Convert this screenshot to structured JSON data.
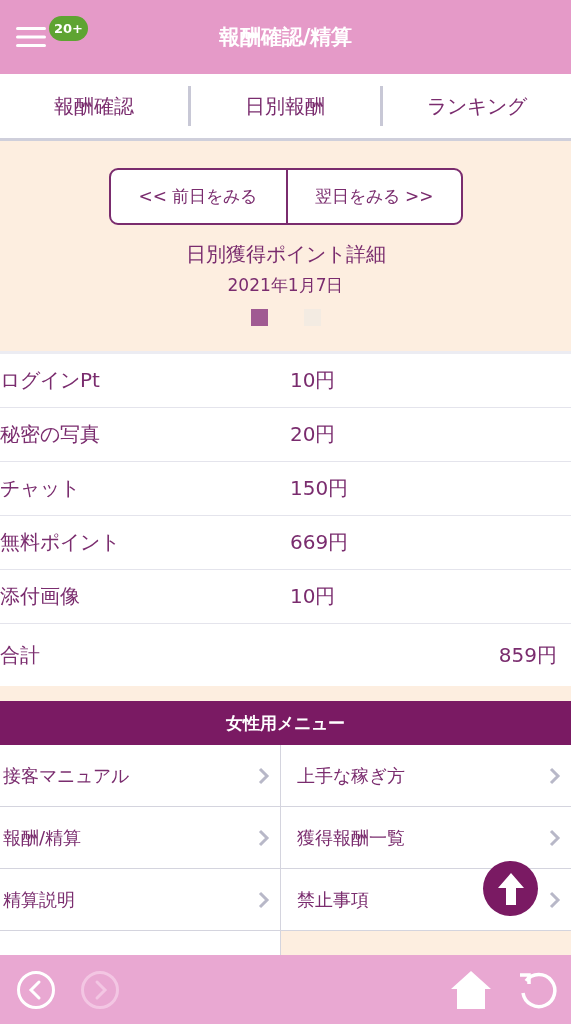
{
  "header": {
    "title": "報酬確認/精算",
    "badge": "20+"
  },
  "tabs": [
    {
      "label": "報酬確認"
    },
    {
      "label": "日別報酬"
    },
    {
      "label": "ランキング"
    }
  ],
  "day_nav": {
    "prev": "<< 前日をみる",
    "next": "翌日をみる >>"
  },
  "detail": {
    "title": "日別獲得ポイント詳細",
    "date": "2021年1月7日"
  },
  "pager": [
    {
      "selected": true
    },
    {
      "selected": false
    }
  ],
  "rows": [
    {
      "kind": "item",
      "name": "ログインPt",
      "value": "10円"
    },
    {
      "kind": "item",
      "name": "秘密の写真",
      "value": "20円"
    },
    {
      "kind": "item",
      "name": "チャット",
      "value": "150円"
    },
    {
      "kind": "item",
      "name": "無料ポイント",
      "value": "669円"
    },
    {
      "kind": "item",
      "name": "添付画像",
      "value": "10円"
    },
    {
      "kind": "total",
      "name": "合計",
      "value": "859円"
    }
  ],
  "menu": {
    "title": "女性用メニュー",
    "items": [
      {
        "label": "接客マニュアル"
      },
      {
        "label": "上手な稼ぎ方"
      },
      {
        "label": "報酬/精算"
      },
      {
        "label": "獲得報酬一覧"
      },
      {
        "label": "精算説明"
      },
      {
        "label": "禁止事項"
      }
    ]
  },
  "bottom_bar": {
    "back_disabled": false,
    "forward_disabled": true
  }
}
